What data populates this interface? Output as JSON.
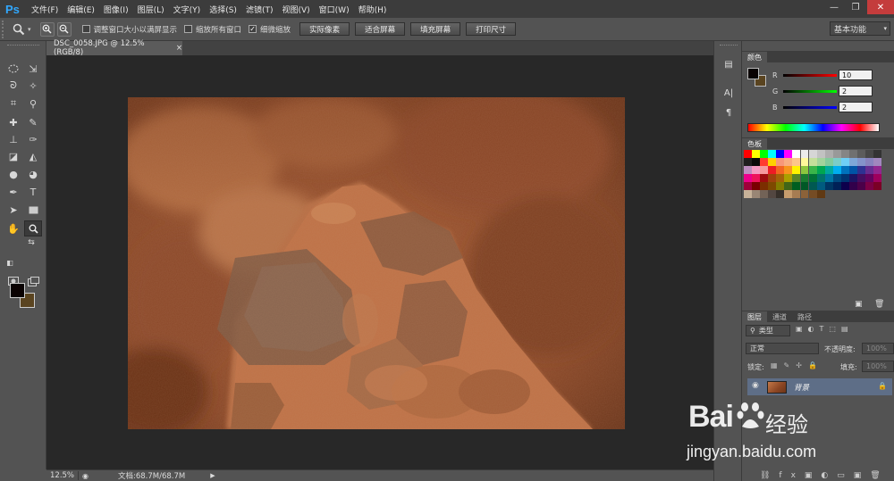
{
  "app": {
    "logo": "Ps"
  },
  "menubar": {
    "items": [
      "文件(F)",
      "编辑(E)",
      "图像(I)",
      "图层(L)",
      "文字(Y)",
      "选择(S)",
      "滤镜(T)",
      "视图(V)",
      "窗口(W)",
      "帮助(H)"
    ]
  },
  "window_controls": {
    "minimize": "—",
    "maximize": "❐",
    "close": "✕"
  },
  "options": {
    "tool_icon": "magnifier-icon",
    "checkbox_resize": "调整窗口大小以满屏显示",
    "checkbox_zoom_all": "缩放所有窗口",
    "checkbox_scrubby": "细微缩放",
    "scrubby_checked": true,
    "btn_actual": "实际像素",
    "btn_fit": "适合屏幕",
    "btn_fill": "填充屏幕",
    "btn_print": "打印尺寸",
    "workspace": "基本功能"
  },
  "document": {
    "tab_title": "DSC_0058.JPG @ 12.5%(RGB/8)",
    "tab_close": "×"
  },
  "status": {
    "zoom": "12.5%",
    "doc_size": "文档:68.7M/68.7M",
    "arrow": "▶"
  },
  "colors": {
    "foreground": "#0a0202",
    "background": "#5a4420"
  },
  "color_panel": {
    "tab": "颜色",
    "channels": [
      {
        "label": "R",
        "value": "10",
        "gradient": "#ff0000"
      },
      {
        "label": "G",
        "value": "2",
        "gradient": "#00ff00"
      },
      {
        "label": "B",
        "value": "2",
        "gradient": "#0000ff"
      }
    ]
  },
  "swatches_panel": {
    "tab": "色板",
    "colors": [
      "#ff0000",
      "#ffff00",
      "#00ff00",
      "#00ffff",
      "#0000ff",
      "#ff00ff",
      "#ffffff",
      "#ebebeb",
      "#d6d6d6",
      "#c2c2c2",
      "#adadad",
      "#999999",
      "#858585",
      "#707070",
      "#5c5c5c",
      "#474747",
      "#333333",
      "#1f1f1f",
      "#0a0a0a",
      "#ff3b30",
      "#ffd000",
      "#f7977a",
      "#f9ad81",
      "#fdc68a",
      "#fff79a",
      "#c4df9b",
      "#a2d39c",
      "#82ca9d",
      "#7bcdc8",
      "#6ecff6",
      "#7ea7d8",
      "#8493ca",
      "#8882be",
      "#a187be",
      "#bc8dbf",
      "#f49ac2",
      "#f6989d",
      "#ed1c24",
      "#f26522",
      "#f7941d",
      "#fff200",
      "#8dc63f",
      "#39b54a",
      "#00a651",
      "#00a99d",
      "#00aeef",
      "#0072bc",
      "#0054a6",
      "#2e3192",
      "#662d91",
      "#92278f",
      "#ec008c",
      "#ed145b",
      "#9e0b0f",
      "#a0410d",
      "#a36209",
      "#aba000",
      "#598527",
      "#1a7b30",
      "#007236",
      "#00746b",
      "#0076a3",
      "#004a80",
      "#003471",
      "#1b1464",
      "#440e62",
      "#630460",
      "#9e005d",
      "#9e0039",
      "#790000",
      "#7b2e00",
      "#7d4900",
      "#827b00",
      "#406618",
      "#005e20",
      "#005826",
      "#005952",
      "#005b7f",
      "#003663",
      "#002157",
      "#0d004c",
      "#32004b",
      "#4b0049",
      "#7b0046",
      "#7a0026",
      "#c7b299",
      "#998675",
      "#736357",
      "#534741",
      "#37302a",
      "#c69c6d",
      "#a67c52",
      "#8c6239",
      "#754c24",
      "#603913"
    ]
  },
  "layers_panel": {
    "tabs": [
      "图层",
      "通道",
      "路径"
    ],
    "filter": "类型",
    "blend_mode": "正常",
    "opacity_label": "不透明度:",
    "opacity_value": "100%",
    "lock_label": "锁定:",
    "fill_label": "填充:",
    "fill_value": "100%",
    "layers": [
      {
        "name": "背景",
        "visible": true,
        "locked": true
      }
    ]
  },
  "watermark": {
    "logo": "Bai",
    "sub": "经验",
    "url": "jingyan.baidu.com"
  }
}
